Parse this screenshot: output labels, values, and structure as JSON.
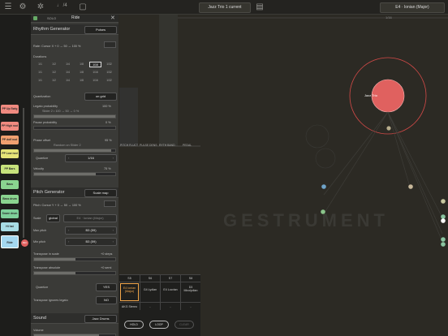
{
  "topbar": {
    "transport_label": "♩ /4",
    "preset_label": "Jazz Trio 1 current",
    "scale_label": "E4 · Ionian (Major)"
  },
  "strip": {
    "buttons": [
      {
        "label": "PP Up Swig",
        "color": "#f08a80"
      },
      {
        "label": "PP High nod",
        "color": "#f08a80"
      },
      {
        "label": "PP dolf nod",
        "color": "#f0a070"
      },
      {
        "label": "PP Low nod",
        "color": "#e6e478"
      },
      {
        "label": "PP Bars",
        "color": "#c7e27c"
      },
      {
        "label": "Bass",
        "color": "#8ad48f"
      },
      {
        "label": "Bass drum",
        "color": "#8ad48f"
      },
      {
        "label": "Snare drum",
        "color": "#7ecf9a"
      },
      {
        "label": "Hi hat",
        "color": "#a8dce4"
      },
      {
        "label": "Ride",
        "color": "#a4d8f0"
      }
    ],
    "record_label": "REC"
  },
  "panel": {
    "title_left": "SOLO",
    "title": "Ride",
    "rhythm": {
      "header": "Rhythm Generator",
      "mode": "Pulses",
      "formula": "Rate: Cursor X + 0 → 50 → 100 %",
      "durations_label": "Durations",
      "durations": [
        "1/1",
        "1/2",
        "1/4",
        "1/8",
        "1/16",
        "1/32",
        "1/1",
        "1/2",
        "1/4",
        "1/8",
        "1/16",
        "1/32",
        "1/1",
        "1/2",
        "1/4",
        "1/8",
        "1/16",
        "1/32"
      ],
      "selected_index": 4,
      "quantization_label": "Quantization",
      "quantization_value": "on grid",
      "legato_label": "Legato probability",
      "legato_value": "100 %",
      "legato_sub": "Slider 2 • 100 → 50 → 0 %",
      "pause_label": "Pause probability",
      "pause_value": "0 %",
      "phase_label": "Phase offset",
      "phase_value": "95 %",
      "phase_sub": "Random on Slider 2",
      "quantize_label": "Quantize",
      "quantize_value": "1/16",
      "velocity_label": "Velocity",
      "velocity_value": "75 %"
    },
    "pitch": {
      "header": "Pitch Generator",
      "mode": "Scale map",
      "formula": "Pitch: Cursor Y + 0 → 50 → 100 %",
      "scale_label": "Scale",
      "scale_global": "global",
      "scale_value": "E4 · Ionian (Major)",
      "max_label": "Max pitch",
      "max_value": "B3 (59)",
      "min_label": "Min pitch",
      "min_value": "B3 (59)",
      "transpose_scale_label": "Transpose in scale",
      "transpose_scale_value": "+0 steps",
      "transpose_abs_label": "Transpose absolute",
      "transpose_abs_value": "+0 semi",
      "quantize_label": "Quantize",
      "quantize_value": "YES",
      "ignore_label": "Transpose ignores legato",
      "ignore_value": "NO"
    },
    "sound": {
      "header": "Sound",
      "value": "Jazz Drums",
      "volume_label": "Volume"
    }
  },
  "canvas": {
    "watermark": "GESTRUMENT",
    "node_label": "Jazz Trio",
    "top_marker": "1/16",
    "col_labels": [
      "PITCH FLUCT",
      "PULSE DENS",
      "RYTH BAND",
      "PEDAL"
    ]
  },
  "bottom": {
    "cols": [
      {
        "head": "S5",
        "name": "E4 Ionian (Major)",
        "active": true
      },
      {
        "head": "S6",
        "name": "G4 Lydian",
        "active": false
      },
      {
        "head": "S7",
        "name": "E4 Locrian",
        "active": false
      },
      {
        "head": "S8",
        "name": "D3 Mixolydian",
        "active": false
      }
    ],
    "row2": [
      "AKG Stereo",
      "-",
      "-",
      "-"
    ],
    "buttons": [
      "HOLD",
      "LOOP",
      "CLEAR"
    ]
  },
  "colors": {
    "accent": "#e0615f",
    "node_ring": "#d44a48",
    "selected": "#ffffff",
    "warning": "#f2a64a"
  }
}
